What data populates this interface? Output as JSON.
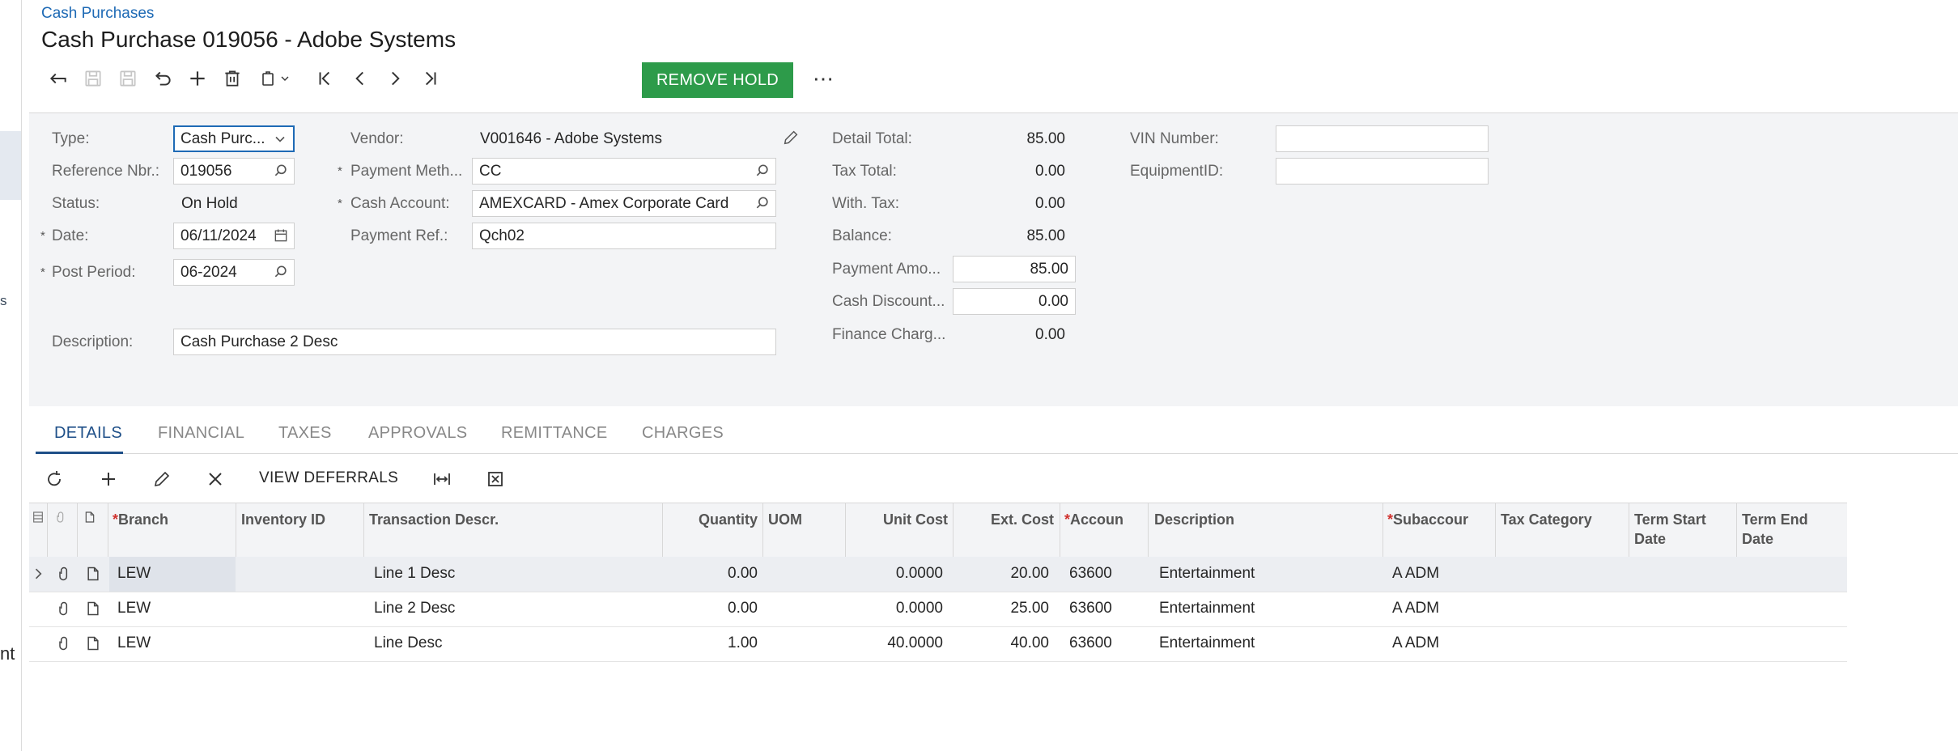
{
  "breadcrumb": "Cash Purchases",
  "page_title": "Cash Purchase 019056 - Adobe Systems",
  "toolbar": {
    "remove_hold_label": "REMOVE HOLD",
    "more_label": "⋯",
    "icons": [
      "back-icon",
      "save-close-icon",
      "save-icon",
      "undo-icon",
      "add-icon",
      "delete-icon",
      "copy-paste-icon",
      "first-icon",
      "previous-icon",
      "next-icon",
      "last-icon"
    ]
  },
  "left_fragments": {
    "top": "s",
    "bottom": "nt"
  },
  "form": {
    "type": {
      "label": "Type:",
      "value": "Cash Purc..."
    },
    "reference": {
      "label": "Reference Nbr.:",
      "value": "019056"
    },
    "status": {
      "label": "Status:",
      "value": "On Hold"
    },
    "date": {
      "label": "Date:",
      "value": "06/11/2024"
    },
    "post_period": {
      "label": "Post Period:",
      "value": "06-2024"
    },
    "description": {
      "label": "Description:",
      "value": "Cash Purchase 2 Desc"
    },
    "vendor": {
      "label": "Vendor:",
      "value": "V001646 - Adobe Systems"
    },
    "payment_method": {
      "label": "Payment Meth...",
      "value": "CC"
    },
    "cash_account": {
      "label": "Cash Account:",
      "value": "AMEXCARD - Amex Corporate Card"
    },
    "payment_ref": {
      "label": "Payment Ref.:",
      "value": "Qch02"
    },
    "detail_total": {
      "label": "Detail Total:",
      "value": "85.00"
    },
    "tax_total": {
      "label": "Tax Total:",
      "value": "0.00"
    },
    "with_tax": {
      "label": "With. Tax:",
      "value": "0.00"
    },
    "balance": {
      "label": "Balance:",
      "value": "85.00"
    },
    "payment_amount": {
      "label": "Payment Amo...",
      "value": "85.00"
    },
    "cash_discount": {
      "label": "Cash Discount...",
      "value": "0.00"
    },
    "finance_charges": {
      "label": "Finance Charg...",
      "value": "0.00"
    },
    "vin_number": {
      "label": "VIN Number:",
      "value": ""
    },
    "equipment_id": {
      "label": "EquipmentID:",
      "value": ""
    }
  },
  "tabs": [
    "DETAILS",
    "FINANCIAL",
    "TAXES",
    "APPROVALS",
    "REMITTANCE",
    "CHARGES"
  ],
  "grid_toolbar": {
    "view_deferrals": "VIEW DEFERRALS"
  },
  "grid": {
    "columns": [
      "Branch",
      "Inventory ID",
      "Transaction Descr.",
      "Quantity",
      "UOM",
      "Unit Cost",
      "Ext. Cost",
      "Accoun",
      "Description",
      "Subaccour",
      "Tax Category",
      "Term Start Date",
      "Term End Date"
    ],
    "columns_wrapped": {
      "term_start": [
        "Term Start",
        "Date"
      ],
      "term_end": [
        "Term End",
        "Date"
      ]
    },
    "rows": [
      {
        "branch": "LEW",
        "inventory_id": "",
        "descr": "Line 1 Desc",
        "quantity": "0.00",
        "uom": "",
        "unit_cost": "0.0000",
        "ext_cost": "20.00",
        "account": "63600",
        "description": "Entertainment",
        "subaccount": "A ADM"
      },
      {
        "branch": "LEW",
        "inventory_id": "",
        "descr": "Line 2 Desc",
        "quantity": "0.00",
        "uom": "",
        "unit_cost": "0.0000",
        "ext_cost": "25.00",
        "account": "63600",
        "description": "Entertainment",
        "subaccount": "A ADM"
      },
      {
        "branch": "LEW",
        "inventory_id": "",
        "descr": "Line Desc",
        "quantity": "1.00",
        "uom": "",
        "unit_cost": "40.0000",
        "ext_cost": "40.00",
        "account": "63600",
        "description": "Entertainment",
        "subaccount": "A ADM"
      }
    ]
  },
  "colors": {
    "accent": "#1e6ab5",
    "success": "#2d9b4a",
    "panel": "#f3f4f6",
    "required": "#d0312d"
  }
}
